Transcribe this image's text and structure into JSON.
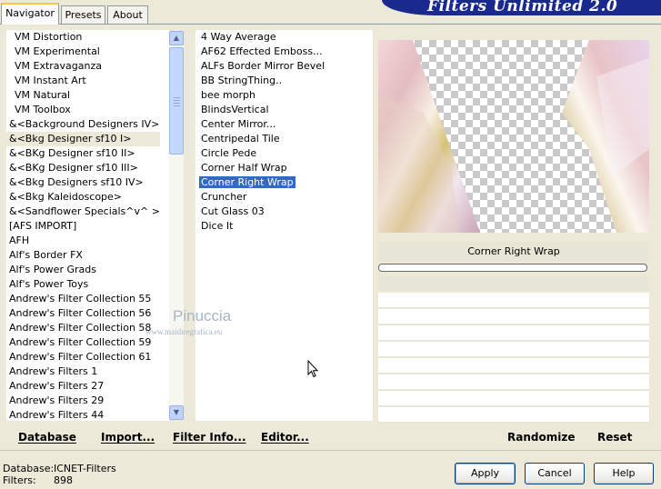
{
  "tabs": [
    {
      "label": "Navigator"
    },
    {
      "label": "Presets"
    },
    {
      "label": "About"
    }
  ],
  "app_title": "Filters Unlimited 2.0",
  "categories": [
    "VM Distortion",
    "VM Experimental",
    "VM Extravaganza",
    "VM Instant Art",
    "VM Natural",
    "VM Toolbox",
    "&<Background Designers IV>",
    "&<Bkg Designer sf10 I>",
    "&<BKg Designer sf10 II>",
    "&<BKg Designer sf10 III>",
    "&<Bkg Designers sf10 IV>",
    "&<Bkg Kaleidoscope>",
    "&<Sandflower Specials^v^ >",
    "[AFS IMPORT]",
    "AFH",
    "Alf's Border FX",
    "Alf's Power Grads",
    "Alf's Power Toys",
    "Andrew's Filter Collection 55",
    "Andrew's Filter Collection 56",
    "Andrew's Filter Collection 58",
    "Andrew's Filter Collection 59",
    "Andrew's Filter Collection 61",
    "Andrew's Filters 1",
    "Andrew's Filters 27",
    "Andrew's Filters 29",
    "Andrew's Filters 44"
  ],
  "selected_category": "&<Bkg Designer sf10 I>",
  "filters": [
    "4 Way Average",
    "AF62 Effected Emboss...",
    "ALFs Border Mirror Bevel",
    "BB StringThing..",
    "bee morph",
    "BlindsVertical",
    "Center Mirror...",
    "Centripedal Tile",
    "Circle Pede",
    "Corner Half Wrap",
    "Corner Right Wrap",
    "Cruncher",
    "Cut Glass  03",
    "Dice It"
  ],
  "selected_filter": "Corner Right Wrap",
  "watermark": {
    "name": "Pinuccia",
    "url": "www.maidiregrafica.eu"
  },
  "preview": {
    "filter_name": "Corner Right Wrap",
    "progress": 0
  },
  "bottom_links": {
    "database": "Database",
    "import": "Import...",
    "filter_info": "Filter Info...",
    "editor": "Editor...",
    "randomize": "Randomize",
    "reset": "Reset"
  },
  "status": {
    "database_label": "Database:",
    "database_value": "ICNET-Filters",
    "filters_label": "Filters:",
    "filters_value": "898"
  },
  "buttons": {
    "apply": "Apply",
    "cancel": "Cancel",
    "help": "Help"
  },
  "colors": {
    "selection": "#316ac5",
    "banner": "#1a2a8c",
    "tab_highlight": "#ffc83c"
  }
}
